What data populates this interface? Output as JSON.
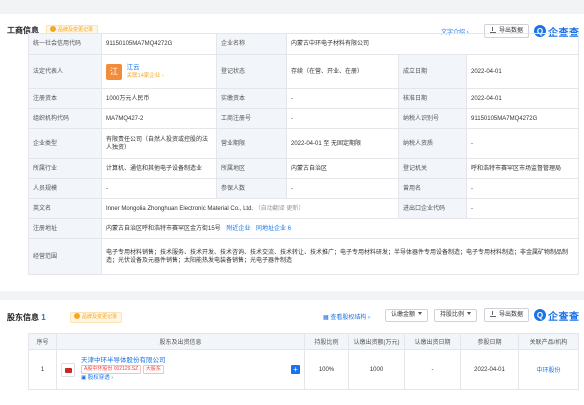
{
  "business": {
    "title": "工商信息",
    "badge": "品牌及变更记录",
    "text_intro": "文字介绍 ›",
    "export": "导出数据",
    "brand_name": "企查查",
    "rows": {
      "credit_code_label": "统一社会信用代码",
      "credit_code": "91150105MA7MQ4272G",
      "company_name_label": "企业名称",
      "company_name": "内蒙古中环电子材料有限公司",
      "legal_label": "法定代表人",
      "legal_avatar": "江",
      "legal_name": "江云",
      "legal_sub": "关联14家企业 ›",
      "reg_status_label": "登记状态",
      "reg_status": "存续（在营、开业、在册）",
      "found_date_label": "成立日期",
      "found_date": "2022-04-01",
      "reg_capital_label": "注册资本",
      "reg_capital": "1000万元人民币",
      "paid_capital_label": "实缴资本",
      "paid_capital": "-",
      "approve_date_label": "核准日期",
      "approve_date": "2022-04-01",
      "org_code_label": "组织机构代码",
      "org_code": "MA7MQ427-2",
      "biz_reg_label": "工商注册号",
      "biz_reg": "-",
      "taxpayer_id_label": "纳税人识别号",
      "taxpayer_id": "91150105MA7MQ4272G",
      "company_type_label": "企业类型",
      "company_type": "有限责任公司（自然人投资或控股的法人独资）",
      "biz_term_label": "营业期限",
      "biz_term": "2022-04-01 至 无固定期限",
      "taxpayer_qual_label": "纳税人资质",
      "taxpayer_qual": "-",
      "industry_label": "所属行业",
      "industry": "计算机、通信和其他电子设备制造业",
      "region_label": "所属地区",
      "region": "内蒙古自治区",
      "reg_authority_label": "登记机关",
      "reg_authority": "呼和浩特市赛罕区市场监督管理局",
      "staff_size_label": "人员规模",
      "staff_size": "-",
      "insured_label": "参保人数",
      "insured": "-",
      "former_name_label": "曾用名",
      "former_name": "-",
      "english_label": "英文名",
      "english": "Inner Mongolia Zhonghuan Electronic Material Co., Ltd.",
      "english_note": "（自动翻译 更新）",
      "import_code_label": "进出口企业代码",
      "import_code": "-",
      "address_label": "注册地址",
      "address": "内蒙古自治区呼和浩特市赛罕区金方街15号",
      "nearby": "附近企业",
      "same_addr": "同地址企业 6",
      "scope_label": "经营范围",
      "scope": "电子专用材料销售；技术服务、技术开发、技术咨询、技术交流、技术转让、技术推广；电子专用材料研发；半导体器件专用设备制造；电子专用材料制造；非金属矿物制品制造；光伏设备及元器件销售；太阳能热发电装备销售；光电子器件制造"
    }
  },
  "share": {
    "title": "股东信息",
    "count": "1",
    "badge": "品牌及变更记录",
    "view_structure": "查看股权结构 ›",
    "filter_amount": "认缴金额",
    "filter_ratio": "持股比例",
    "export": "导出数据",
    "brand_name": "企查查",
    "headers": [
      "序号",
      "股东及出资信息",
      "持股比例",
      "认缴出资额(万元)",
      "认缴出资日期",
      "参股日期",
      "关联产品/机构"
    ],
    "rows": [
      {
        "index": "1",
        "name": "天津中环半导体股份有限公司",
        "tag1": "A股中环股份 002129.SZ",
        "tag2": "大股东",
        "link": "股权穿透 ›",
        "ratio": "100%",
        "amount": "1000",
        "sub_date": "-",
        "join_date": "2022-04-01",
        "related": "中环股份"
      }
    ]
  }
}
